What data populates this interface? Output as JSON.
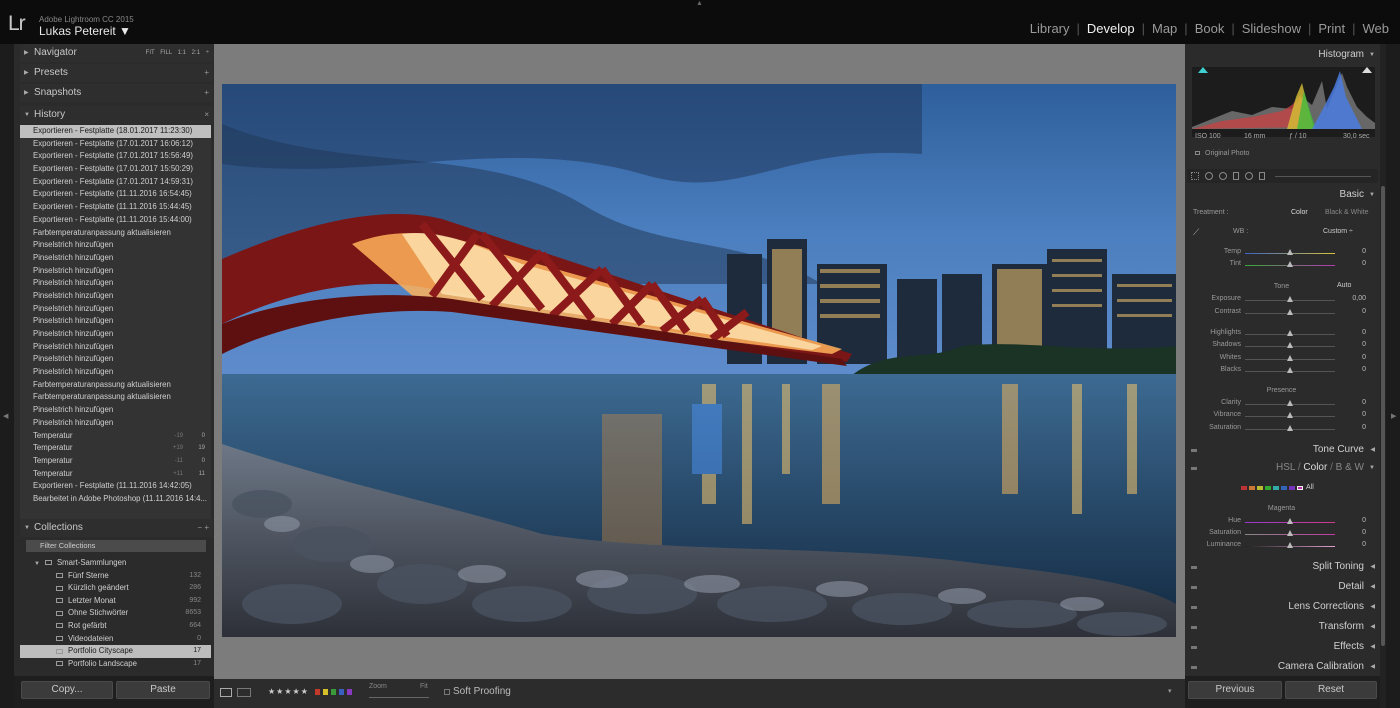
{
  "app": {
    "logo": "Lr",
    "name": "Adobe Lightroom CC 2015",
    "user": "Lukas Petereit ▼"
  },
  "modules": [
    {
      "label": "Library",
      "active": false
    },
    {
      "label": "Develop",
      "active": true
    },
    {
      "label": "Map",
      "active": false
    },
    {
      "label": "Book",
      "active": false
    },
    {
      "label": "Slideshow",
      "active": false
    },
    {
      "label": "Print",
      "active": false
    },
    {
      "label": "Web",
      "active": false
    }
  ],
  "left": {
    "navigator": {
      "title": "Navigator",
      "sizes": "FIT FILL 1:1 2:1 ÷"
    },
    "presets": "Presets",
    "snapshots": "Snapshots",
    "history": {
      "title": "History",
      "items": [
        {
          "label": "Exportieren - Festplatte (18.01.2017 11:23:30)",
          "v1": "",
          "v2": ""
        },
        {
          "label": "Exportieren - Festplatte (17.01.2017 16:06:12)",
          "v1": "",
          "v2": ""
        },
        {
          "label": "Exportieren - Festplatte (17.01.2017 15:56:49)",
          "v1": "",
          "v2": ""
        },
        {
          "label": "Exportieren - Festplatte (17.01.2017 15:50:29)",
          "v1": "",
          "v2": ""
        },
        {
          "label": "Exportieren - Festplatte (17.01.2017 14:59:31)",
          "v1": "",
          "v2": ""
        },
        {
          "label": "Exportieren - Festplatte (11.11.2016 16:54:45)",
          "v1": "",
          "v2": ""
        },
        {
          "label": "Exportieren - Festplatte (11.11.2016 15:44:45)",
          "v1": "",
          "v2": ""
        },
        {
          "label": "Exportieren - Festplatte (11.11.2016 15:44:00)",
          "v1": "",
          "v2": ""
        },
        {
          "label": "Farbtemperaturanpassung aktualisieren",
          "v1": "",
          "v2": ""
        },
        {
          "label": "Pinselstrich hinzufügen",
          "v1": "",
          "v2": ""
        },
        {
          "label": "Pinselstrich hinzufügen",
          "v1": "",
          "v2": ""
        },
        {
          "label": "Pinselstrich hinzufügen",
          "v1": "",
          "v2": ""
        },
        {
          "label": "Pinselstrich hinzufügen",
          "v1": "",
          "v2": ""
        },
        {
          "label": "Pinselstrich hinzufügen",
          "v1": "",
          "v2": ""
        },
        {
          "label": "Pinselstrich hinzufügen",
          "v1": "",
          "v2": ""
        },
        {
          "label": "Pinselstrich hinzufügen",
          "v1": "",
          "v2": ""
        },
        {
          "label": "Pinselstrich hinzufügen",
          "v1": "",
          "v2": ""
        },
        {
          "label": "Pinselstrich hinzufügen",
          "v1": "",
          "v2": ""
        },
        {
          "label": "Pinselstrich hinzufügen",
          "v1": "",
          "v2": ""
        },
        {
          "label": "Pinselstrich hinzufügen",
          "v1": "",
          "v2": ""
        },
        {
          "label": "Farbtemperaturanpassung aktualisieren",
          "v1": "",
          "v2": ""
        },
        {
          "label": "Farbtemperaturanpassung aktualisieren",
          "v1": "",
          "v2": ""
        },
        {
          "label": "Pinselstrich hinzufügen",
          "v1": "",
          "v2": ""
        },
        {
          "label": "Pinselstrich hinzufügen",
          "v1": "",
          "v2": ""
        },
        {
          "label": "Temperatur",
          "v1": "-19",
          "v2": "0"
        },
        {
          "label": "Temperatur",
          "v1": "+19",
          "v2": "19"
        },
        {
          "label": "Temperatur",
          "v1": "-11",
          "v2": "0"
        },
        {
          "label": "Temperatur",
          "v1": "+11",
          "v2": "11"
        },
        {
          "label": "Exportieren - Festplatte (11.11.2016 14:42:05)",
          "v1": "",
          "v2": ""
        },
        {
          "label": "Bearbeitet in Adobe Photoshop (11.11.2016 14:4...",
          "v1": "",
          "v2": ""
        }
      ]
    },
    "collections": {
      "title": "Collections",
      "filter": "Filter Collections",
      "group": "Smart-Sammlungen",
      "items": [
        {
          "label": "Fünf Sterne",
          "count": "132",
          "selected": false
        },
        {
          "label": "Kürzlich geändert",
          "count": "286",
          "selected": false
        },
        {
          "label": "Letzter Monat",
          "count": "992",
          "selected": false
        },
        {
          "label": "Ohne Stichwörter",
          "count": "8653",
          "selected": false
        },
        {
          "label": "Rot gefärbt",
          "count": "664",
          "selected": false
        },
        {
          "label": "Videodateien",
          "count": "0",
          "selected": false
        },
        {
          "label": "Portfolio Cityscape",
          "count": "17",
          "selected": true
        },
        {
          "label": "Portfolio Landscape",
          "count": "17",
          "selected": false
        }
      ]
    },
    "copy_label": "Copy...",
    "paste_label": "Paste"
  },
  "toolbar": {
    "stars": "★★★★★",
    "zoom_label": "Zoom",
    "zoom_value": "Fit",
    "soft_proofing": "Soft Proofing"
  },
  "right": {
    "histogram": {
      "title": "Histogram",
      "iso": "ISO 100",
      "focal": "16 mm",
      "aperture": "ƒ / 10",
      "shutter": "30,0 sec",
      "original_photo": "Original Photo"
    },
    "basic": {
      "title": "Basic",
      "treatment_label": "Treatment :",
      "color": "Color",
      "bw": "Black & White",
      "wb_label": "WB :",
      "wb_value": "Custom ÷",
      "tone_label": "Tone",
      "auto_label": "Auto",
      "presence_label": "Presence",
      "sliders": [
        {
          "label": "Temp",
          "value": "0",
          "pos": 0.5
        },
        {
          "label": "Tint",
          "value": "0",
          "pos": 0.5
        },
        {
          "label": "Exposure",
          "value": "0,00",
          "pos": 0.5
        },
        {
          "label": "Contrast",
          "value": "0",
          "pos": 0.5
        },
        {
          "label": "Highlights",
          "value": "0",
          "pos": 0.5
        },
        {
          "label": "Shadows",
          "value": "0",
          "pos": 0.5
        },
        {
          "label": "Whites",
          "value": "0",
          "pos": 0.5
        },
        {
          "label": "Blacks",
          "value": "0",
          "pos": 0.5
        },
        {
          "label": "Clarity",
          "value": "0",
          "pos": 0.5
        },
        {
          "label": "Vibrance",
          "value": "0",
          "pos": 0.5
        },
        {
          "label": "Saturation",
          "value": "0",
          "pos": 0.5
        }
      ]
    },
    "tone_curve": "Tone Curve",
    "hsl": {
      "hsl_tab": "HSL",
      "color_tab": "Color",
      "bw_tab": "B & W",
      "all_label": "All",
      "channel": "Magenta",
      "sliders": [
        {
          "label": "Hue",
          "value": "0",
          "pos": 0.5
        },
        {
          "label": "Saturation",
          "value": "0",
          "pos": 0.5
        },
        {
          "label": "Luminance",
          "value": "0",
          "pos": 0.5
        }
      ]
    },
    "split_toning": "Split Toning",
    "detail": "Detail",
    "lens_corrections": "Lens Corrections",
    "transform": "Transform",
    "effects": "Effects",
    "camera_calibration": "Camera Calibration",
    "previous_label": "Previous",
    "reset_label": "Reset"
  }
}
